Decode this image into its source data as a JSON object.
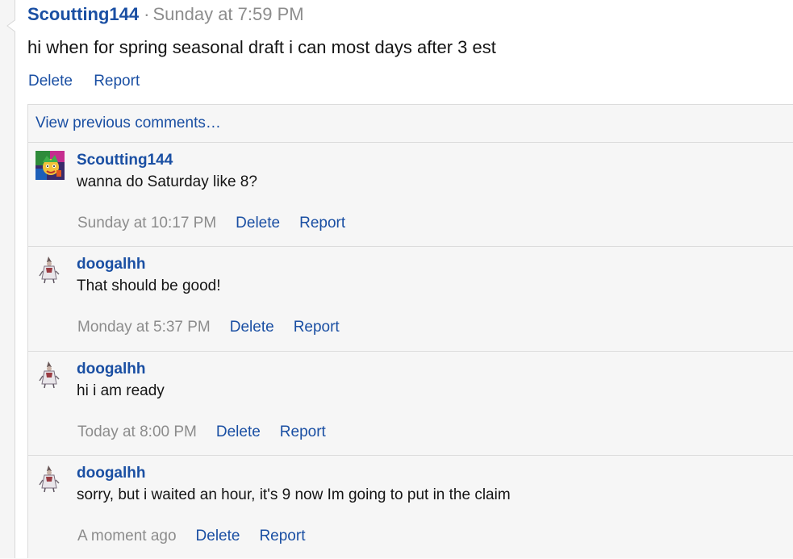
{
  "post": {
    "author": "Scoutting144",
    "separator": "·",
    "time": "Sunday at 7:59 PM",
    "body": "hi when for spring seasonal draft i can most days after 3 est",
    "actions": {
      "delete": "Delete",
      "report": "Report"
    }
  },
  "comments_section": {
    "view_previous": "View previous comments…",
    "items": [
      {
        "author": "Scoutting144",
        "avatar": "colorful-character-avatar",
        "text": "wanna do Saturday like 8?",
        "time": "Sunday at 10:17 PM",
        "delete": "Delete",
        "report": "Report"
      },
      {
        "author": "doogalhh",
        "avatar": "robed-figure-avatar",
        "text": "That should be good!",
        "time": "Monday at 5:37 PM",
        "delete": "Delete",
        "report": "Report"
      },
      {
        "author": "doogalhh",
        "avatar": "robed-figure-avatar",
        "text": "hi i am ready",
        "time": "Today at 8:00 PM",
        "delete": "Delete",
        "report": "Report"
      },
      {
        "author": "doogalhh",
        "avatar": "robed-figure-avatar",
        "text": "sorry, but i waited an hour, it's 9 now Im going to put in the claim",
        "time": "A moment ago",
        "delete": "Delete",
        "report": "Report"
      }
    ]
  },
  "colors": {
    "link": "#1a4fa3",
    "muted": "#8c8c8c",
    "text": "#141414",
    "panel": "#f6f6f6",
    "border": "#dcdcdc"
  }
}
